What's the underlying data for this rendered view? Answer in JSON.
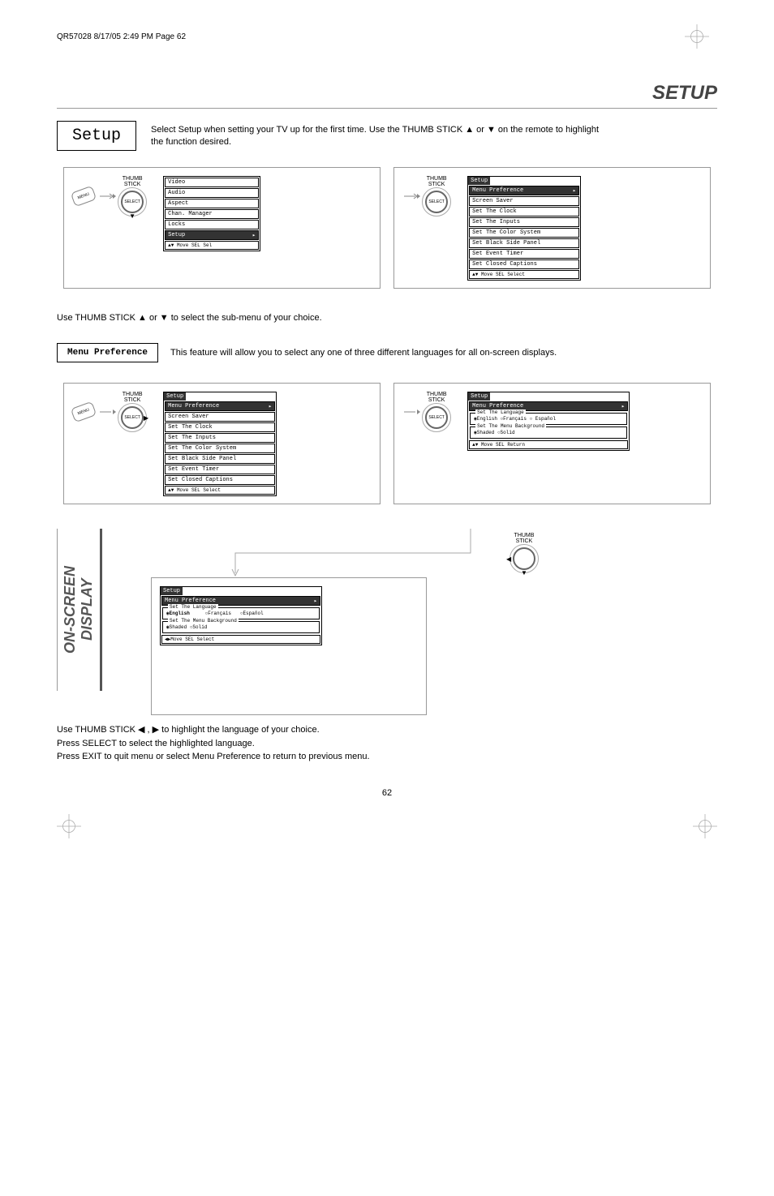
{
  "header": "QR57028  8/17/05  2:49 PM  Page 62",
  "title": "SETUP",
  "setup": {
    "label": "Setup",
    "desc1": "Select Setup when setting your TV up for the first time.  Use the THUMB STICK ▲ or ▼ on the remote to highlight",
    "desc2": "the function desired."
  },
  "labels": {
    "thumbstick": "THUMB\nSTICK",
    "menu": "MENU",
    "select": "SELECT"
  },
  "menu1": {
    "items": [
      "Video",
      "Audio",
      "Aspect",
      "Chan. Manager",
      "Locks"
    ],
    "selected": "Setup",
    "foot": "▲▼ Move  SEL Sel"
  },
  "menu2": {
    "title": "Setup",
    "selected": "Menu Preference",
    "items": [
      "Screen Saver",
      "Set The Clock",
      "Set The Inputs",
      "Set The Color System",
      "Set Black Side Panel",
      "Set Event Timer",
      "Set Closed Captions"
    ],
    "foot": "▲▼ Move  SEL Select"
  },
  "note1": "Use THUMB STICK ▲ or ▼ to select the sub-menu of your choice.",
  "pref": {
    "label": "Menu Preference",
    "desc": "This feature will allow you to select any one of three different languages for all on-screen displays."
  },
  "menu3": {
    "title": "Setup",
    "selected": "Menu Preference",
    "items": [
      "Screen Saver",
      "Set The Clock",
      "Set The Inputs",
      "Set The Color System",
      "Set Black Side Panel",
      "Set Event Timer",
      "Set Closed Captions"
    ],
    "foot": "▲▼ Move  SEL Select"
  },
  "menu4": {
    "title": "Setup",
    "selected": "Menu Preference",
    "fieldset1_legend": "Set The Language",
    "lang_opts": "◉English   ○Français   ○ Español",
    "fieldset2_legend": "Set The Menu Background",
    "bg_opts": "◉Shaded   ○Solid",
    "foot": "▲▼ Move  SEL Return"
  },
  "menu5": {
    "title": "Setup",
    "selected": "Menu Preference",
    "fieldset1_legend": "Set The Language",
    "lang_opts": "◉English   ○Français   ○Español",
    "fieldset2_legend": "Set The Menu Background",
    "bg_opts": "◉Shaded   ○Solid",
    "foot": "◀▶Move  SEL Select"
  },
  "side": "ON-SCREEN DISPLAY",
  "end": {
    "l1": "Use THUMB STICK ◀ , ▶ to highlight the language of your choice.",
    "l2": "Press SELECT to select the highlighted language.",
    "l3": "Press EXIT to quit menu or select Menu Preference to return to previous menu."
  },
  "page_num": "62"
}
